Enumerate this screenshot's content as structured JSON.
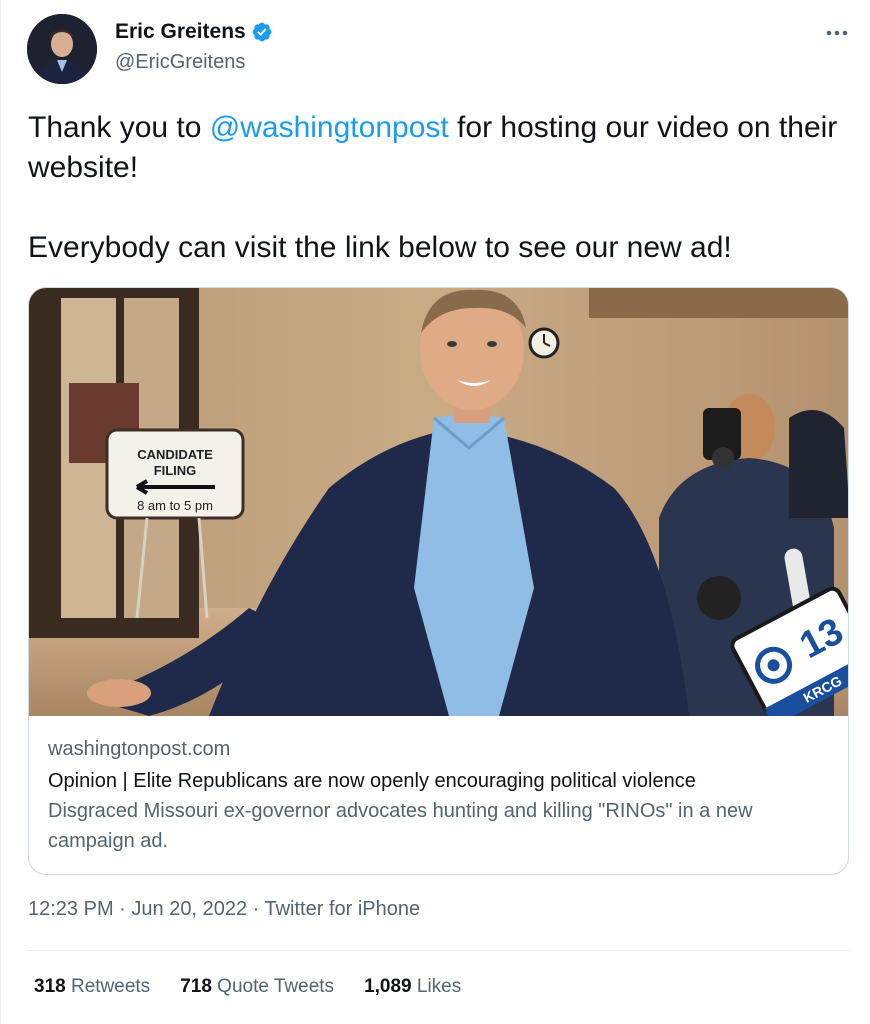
{
  "author": {
    "display_name": "Eric Greitens",
    "handle": "@EricGreitens",
    "verified_icon": "verified-badge-icon",
    "avatar_icon": "avatar"
  },
  "tweet": {
    "text_line1_prefix": "Thank you to ",
    "mention": "@washingtonpost",
    "text_line1_suffix": " for hosting our video on their website!",
    "text_line2": "Everybody can visit the link below to see our new ad!"
  },
  "card": {
    "domain": "washingtonpost.com",
    "title": "Opinion | Elite Republicans are now openly encouraging political violence",
    "description": "Disgraced Missouri ex-governor advocates hunting and killing \"RINOs\" in a new campaign ad.",
    "image": {
      "sign_line1": "CANDIDATE",
      "sign_line2": "FILING",
      "sign_hours": "8 am to 5 pm",
      "mic_number": "13",
      "mic_station": "KRCG"
    }
  },
  "meta": {
    "time": "12:23 PM",
    "separator": "·",
    "date": "Jun 20, 2022",
    "source": "Twitter for iPhone"
  },
  "stats": {
    "retweets_count": "318",
    "retweets_label": "Retweets",
    "quotes_count": "718",
    "quotes_label": "Quote Tweets",
    "likes_count": "1,089",
    "likes_label": "Likes"
  },
  "colors": {
    "link": "#1d9bf0",
    "secondary_text": "#536471",
    "border": "#cfd9de"
  }
}
